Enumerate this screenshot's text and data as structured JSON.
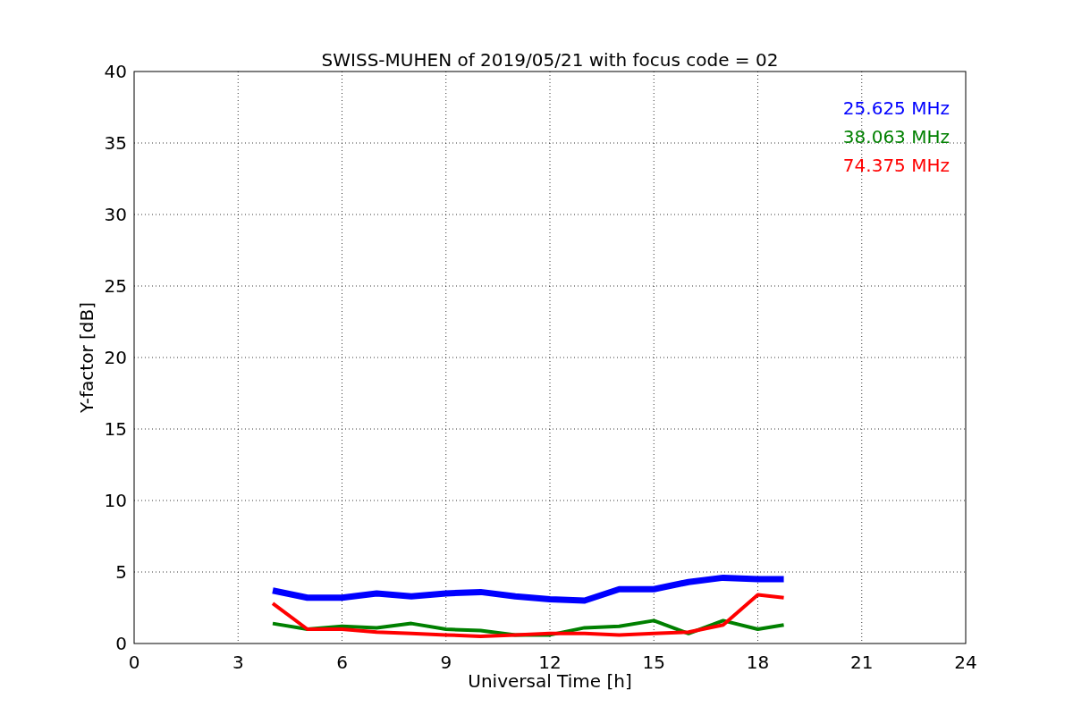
{
  "chart_data": {
    "type": "line",
    "title": "SWISS-MUHEN of 2019/05/21 with focus code = 02",
    "xlabel": "Universal Time [h]",
    "ylabel": "Y-factor [dB]",
    "x": [
      4,
      5,
      6,
      7,
      8,
      9,
      10,
      11,
      12,
      13,
      14,
      15,
      16,
      17,
      18,
      18.75
    ],
    "series": [
      {
        "name": "25.625 MHz",
        "color": "#0000ff",
        "values": [
          3.7,
          3.2,
          3.2,
          3.5,
          3.3,
          3.5,
          3.6,
          3.3,
          3.1,
          3.0,
          3.8,
          3.8,
          4.3,
          4.6,
          4.5,
          4.5
        ]
      },
      {
        "name": "38.063 MHz",
        "color": "#008000",
        "values": [
          1.4,
          1.0,
          1.2,
          1.1,
          1.4,
          1.0,
          0.9,
          0.6,
          0.6,
          1.1,
          1.2,
          1.6,
          0.7,
          1.6,
          1.0,
          1.3
        ]
      },
      {
        "name": "74.375 MHz",
        "color": "#ff0000",
        "values": [
          2.8,
          1.0,
          1.0,
          0.8,
          0.7,
          0.6,
          0.5,
          0.6,
          0.7,
          0.7,
          0.6,
          0.7,
          0.8,
          1.3,
          3.4,
          3.2
        ]
      }
    ],
    "grid": true,
    "xlim": [
      0,
      24
    ],
    "ylim": [
      0,
      40
    ],
    "xticks": [
      0,
      3,
      6,
      9,
      12,
      15,
      18,
      21,
      24
    ],
    "yticks": [
      0,
      5,
      10,
      15,
      20,
      25,
      30,
      35,
      40
    ]
  }
}
